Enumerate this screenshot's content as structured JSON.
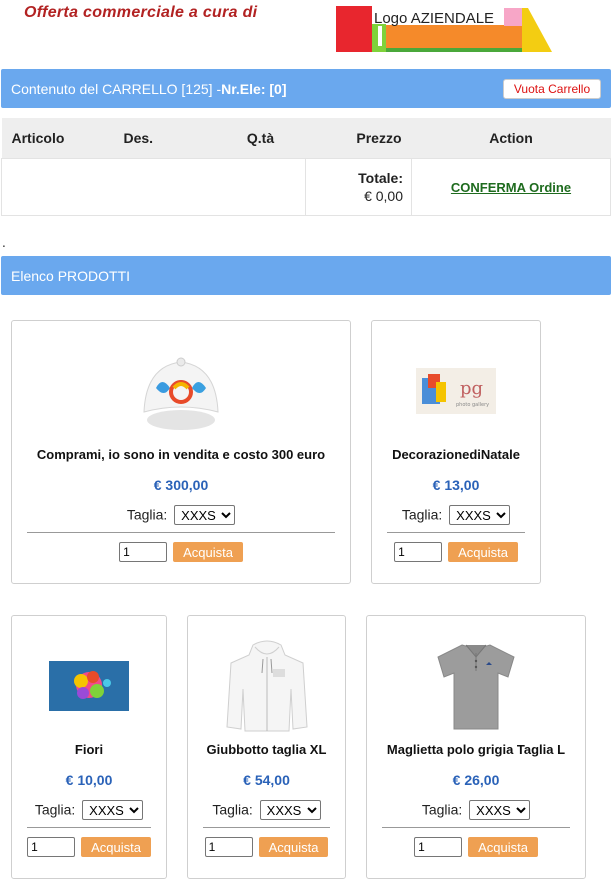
{
  "header": {
    "offer_text": "Offerta commerciale a cura di",
    "logo_text": "Logo AZIENDALE"
  },
  "cart": {
    "title": "Contenuto del CARRELLO [125] - ",
    "count_text": "Nr.Ele: [0]",
    "empty_button": "Vuota Carrello",
    "columns": [
      "Articolo",
      "Des.",
      "Q.tà",
      "Prezzo",
      "Action"
    ],
    "total_label": "Totale:",
    "total_value": "€ 0,00",
    "confirm_label": "CONFERMA Ordine"
  },
  "separator": ".",
  "products_bar": "Elenco PRODOTTI",
  "products": [
    {
      "name": "Comprami, io sono in vendita e costo 300 euro",
      "price": "€ 300,00",
      "size_label": "Taglia:",
      "size_value": "XXXS",
      "qty": "1",
      "buy_label": "Acquista",
      "image": "cap-icon"
    },
    {
      "name": "DecorazionediNatale",
      "price": "€ 13,00",
      "size_label": "Taglia:",
      "size_value": "XXXS",
      "qty": "1",
      "buy_label": "Acquista",
      "image": "photo-gallery-icon"
    },
    {
      "name": "Fiori",
      "price": "€ 10,00",
      "size_label": "Taglia:",
      "size_value": "XXXS",
      "qty": "1",
      "buy_label": "Acquista",
      "image": "flowers-icon"
    },
    {
      "name": "Giubbotto taglia XL",
      "price": "€ 54,00",
      "size_label": "Taglia:",
      "size_value": "XXXS",
      "qty": "1",
      "buy_label": "Acquista",
      "image": "hoodie-icon"
    },
    {
      "name": "Maglietta polo grigia Taglia L",
      "price": "€ 26,00",
      "size_label": "Taglia:",
      "size_value": "XXXS",
      "qty": "1",
      "buy_label": "Acquista",
      "image": "polo-shirt-icon"
    }
  ],
  "colors": {
    "bar": "#6aa8ee",
    "price": "#2a62b8",
    "buy_button": "#efa052",
    "confirm": "#1e6b1e",
    "offer_text": "#b22222"
  }
}
